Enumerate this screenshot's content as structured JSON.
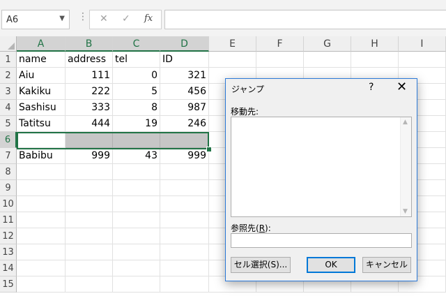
{
  "formula_bar": {
    "name_box": "A6",
    "separator": "⋮",
    "cancel_glyph": "✕",
    "enter_glyph": "✓",
    "fx_label": "fx",
    "formula_value": ""
  },
  "columns": [
    "A",
    "B",
    "C",
    "D",
    "E",
    "F",
    "G",
    "H",
    "I"
  ],
  "rows": [
    "1",
    "2",
    "3",
    "4",
    "5",
    "6",
    "7",
    "8",
    "9",
    "10",
    "11",
    "12",
    "13",
    "14",
    "15"
  ],
  "table": {
    "headers": [
      "name",
      "address",
      "tel",
      "ID"
    ],
    "data": [
      [
        "Aiu",
        "111",
        "0",
        "321"
      ],
      [
        "Kakiku",
        "222",
        "5",
        "456"
      ],
      [
        "Sashisu",
        "333",
        "8",
        "987"
      ],
      [
        "Tatitsu",
        "444",
        "19",
        "246"
      ],
      [
        "",
        "",
        "",
        ""
      ],
      [
        "Babibu",
        "999",
        "43",
        "999"
      ]
    ]
  },
  "dialog": {
    "title": "ジャンプ",
    "help": "?",
    "close": "✕",
    "goto_label": "移動先:",
    "reference_label_pre": "参照先(",
    "reference_label_key": "R",
    "reference_label_post": "):",
    "reference_value": "",
    "special_button": "セル選択(S)...",
    "ok_button": "OK",
    "cancel_button": "キャンセル"
  },
  "colors": {
    "selection_green": "#217346",
    "dialog_border": "#2b79d8",
    "highlight_gray": "#c6c6c6"
  }
}
